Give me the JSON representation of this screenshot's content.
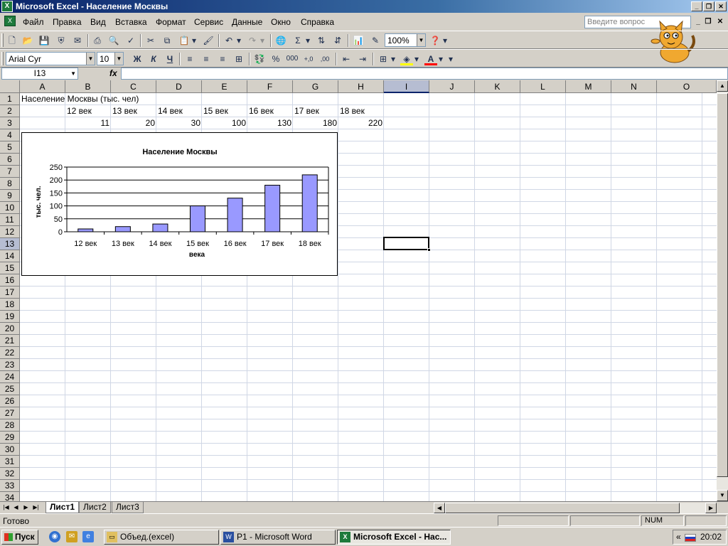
{
  "window": {
    "title": "Microsoft Excel - Население Москвы"
  },
  "menu": {
    "items": [
      "Файл",
      "Правка",
      "Вид",
      "Вставка",
      "Формат",
      "Сервис",
      "Данные",
      "Окно",
      "Справка"
    ],
    "help_placeholder": "Введите вопрос"
  },
  "toolbar": {
    "zoom": "100%",
    "font_name": "Arial Cyr",
    "font_size": "10"
  },
  "formula_bar": {
    "name_box": "I13",
    "fx": "fx",
    "content": ""
  },
  "grid": {
    "columns": [
      "A",
      "B",
      "C",
      "D",
      "E",
      "F",
      "G",
      "H",
      "I",
      "J",
      "K",
      "L",
      "M",
      "N",
      "O"
    ],
    "selected_column": "I",
    "rows": [
      "1",
      "2",
      "3",
      "4",
      "5",
      "6",
      "7",
      "8",
      "9",
      "10",
      "11",
      "12",
      "13",
      "14",
      "15",
      "16",
      "17",
      "18",
      "19",
      "20",
      "21",
      "22",
      "23",
      "24",
      "25",
      "26",
      "27",
      "28",
      "29",
      "30",
      "31",
      "32",
      "33",
      "34"
    ],
    "selected_row": "13",
    "cells": {
      "A1": "Население Москвы (тыс. чел)",
      "row2": [
        "12 век",
        "13 век",
        "14 век",
        "15 век",
        "16 век",
        "17 век",
        "18 век"
      ],
      "row3": [
        "11",
        "20",
        "30",
        "100",
        "130",
        "180",
        "220"
      ]
    }
  },
  "chart_data": {
    "type": "bar",
    "title": "Население Москвы",
    "categories": [
      "12 век",
      "13 век",
      "14 век",
      "15 век",
      "16 век",
      "17 век",
      "18 век"
    ],
    "values": [
      11,
      20,
      30,
      100,
      130,
      180,
      220
    ],
    "xlabel": "века",
    "ylabel": "тыс. чел.",
    "ylim": [
      0,
      250
    ],
    "yticks": [
      "0",
      "50",
      "100",
      "150",
      "200",
      "250"
    ],
    "grid": true,
    "bar_color": "#9999ff",
    "legend": "none"
  },
  "sheets": {
    "tabs": [
      "Лист1",
      "Лист2",
      "Лист3"
    ],
    "active": "Лист1"
  },
  "status": {
    "ready": "Готово",
    "num": "NUM"
  },
  "taskbar": {
    "start": "Пуск",
    "tasks": [
      "Объед.(excel)",
      "P1 - Microsoft Word",
      "Microsoft Excel - Нас..."
    ],
    "tray_lang": "«",
    "clock": "20:02"
  },
  "colors": {
    "title_start": "#0a246a",
    "chart_bar": "#9999ff",
    "excel_green": "#1e7a3c"
  }
}
